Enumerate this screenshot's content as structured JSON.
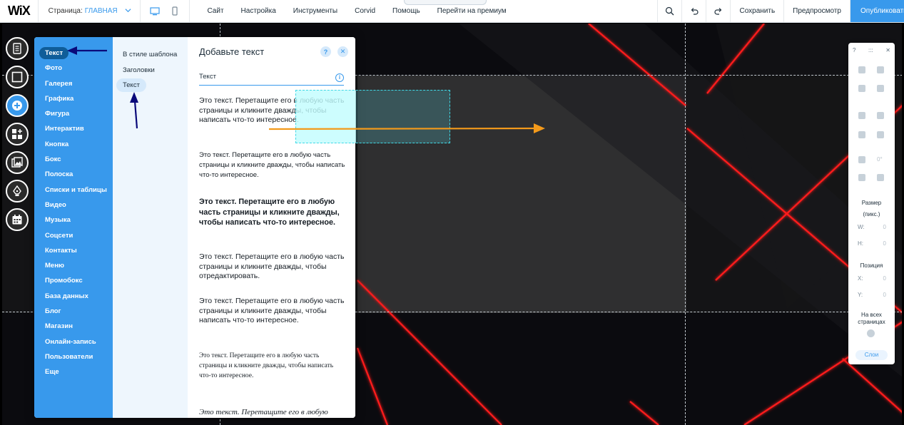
{
  "topbar": {
    "logo": "WiX",
    "page_label": "Страница:",
    "page_name": "ГЛАВНАЯ",
    "menu": [
      "Сайт",
      "Настройка",
      "Инструменты",
      "Corvid",
      "Помощь",
      "Перейти на премиум"
    ],
    "save": "Сохранить",
    "preview": "Предпросмотр",
    "publish": "Опубликовать"
  },
  "categories": [
    "Текст",
    "Фото",
    "Галерея",
    "Графика",
    "Фигура",
    "Интерактив",
    "Кнопка",
    "Бокс",
    "Полоска",
    "Списки и таблицы",
    "Видео",
    "Музыка",
    "Соцсети",
    "Контакты",
    "Меню",
    "Промобокс",
    "База данных",
    "Блог",
    "Магазин",
    "Онлайн-запись",
    "Пользователи",
    "Еще"
  ],
  "subcategories": [
    "В стиле шаблона",
    "Заголовки",
    "Текст"
  ],
  "panel": {
    "title": "Добавьте текст",
    "help_icon": "?",
    "close_icon": "✕",
    "section": "Текст",
    "info_icon": "i",
    "samples": [
      "Это текст. Перетащите его в любую часть страницы и кликните дважды, чтобы написать что-то интересное.",
      "Это текст. Перетащите его в любую часть страницы и кликните дважды, чтобы написать что-то интересное.",
      "Это текст. Перетащите его в любую часть страницы и кликните дважды, чтобы написать что-то интересное.",
      "Это текст. Перетащите его в любую часть страницы и кликните дважды, чтобы отредактировать.",
      "Это текст. Перетащите его в любую часть страницы и кликните дважды, чтобы написать что-то интересное.",
      "Это текст. Перетащите его в любую часть страницы и кликните дважды, чтобы написать что-то интересное.",
      "Это текст. Перетащите его в любую"
    ]
  },
  "tools": {
    "help": "?",
    "drag": ":::",
    "close": "✕",
    "rotation": "0°",
    "size_label": "Размер",
    "size_unit": "(пикс.)",
    "w_label": "W:",
    "w_value": "0",
    "h_label": "H:",
    "h_value": "0",
    "position_label": "Позиция",
    "x_label": "X:",
    "x_value": "0",
    "y_label": "Y:",
    "y_value": "0",
    "all_pages": "На всех страницах",
    "layers": "Слои"
  },
  "colors": {
    "accent": "#3899ec",
    "arrow_blue": "#0a0a7a",
    "arrow_orange": "#f39a1b",
    "neon_red": "#ff1a1a"
  }
}
